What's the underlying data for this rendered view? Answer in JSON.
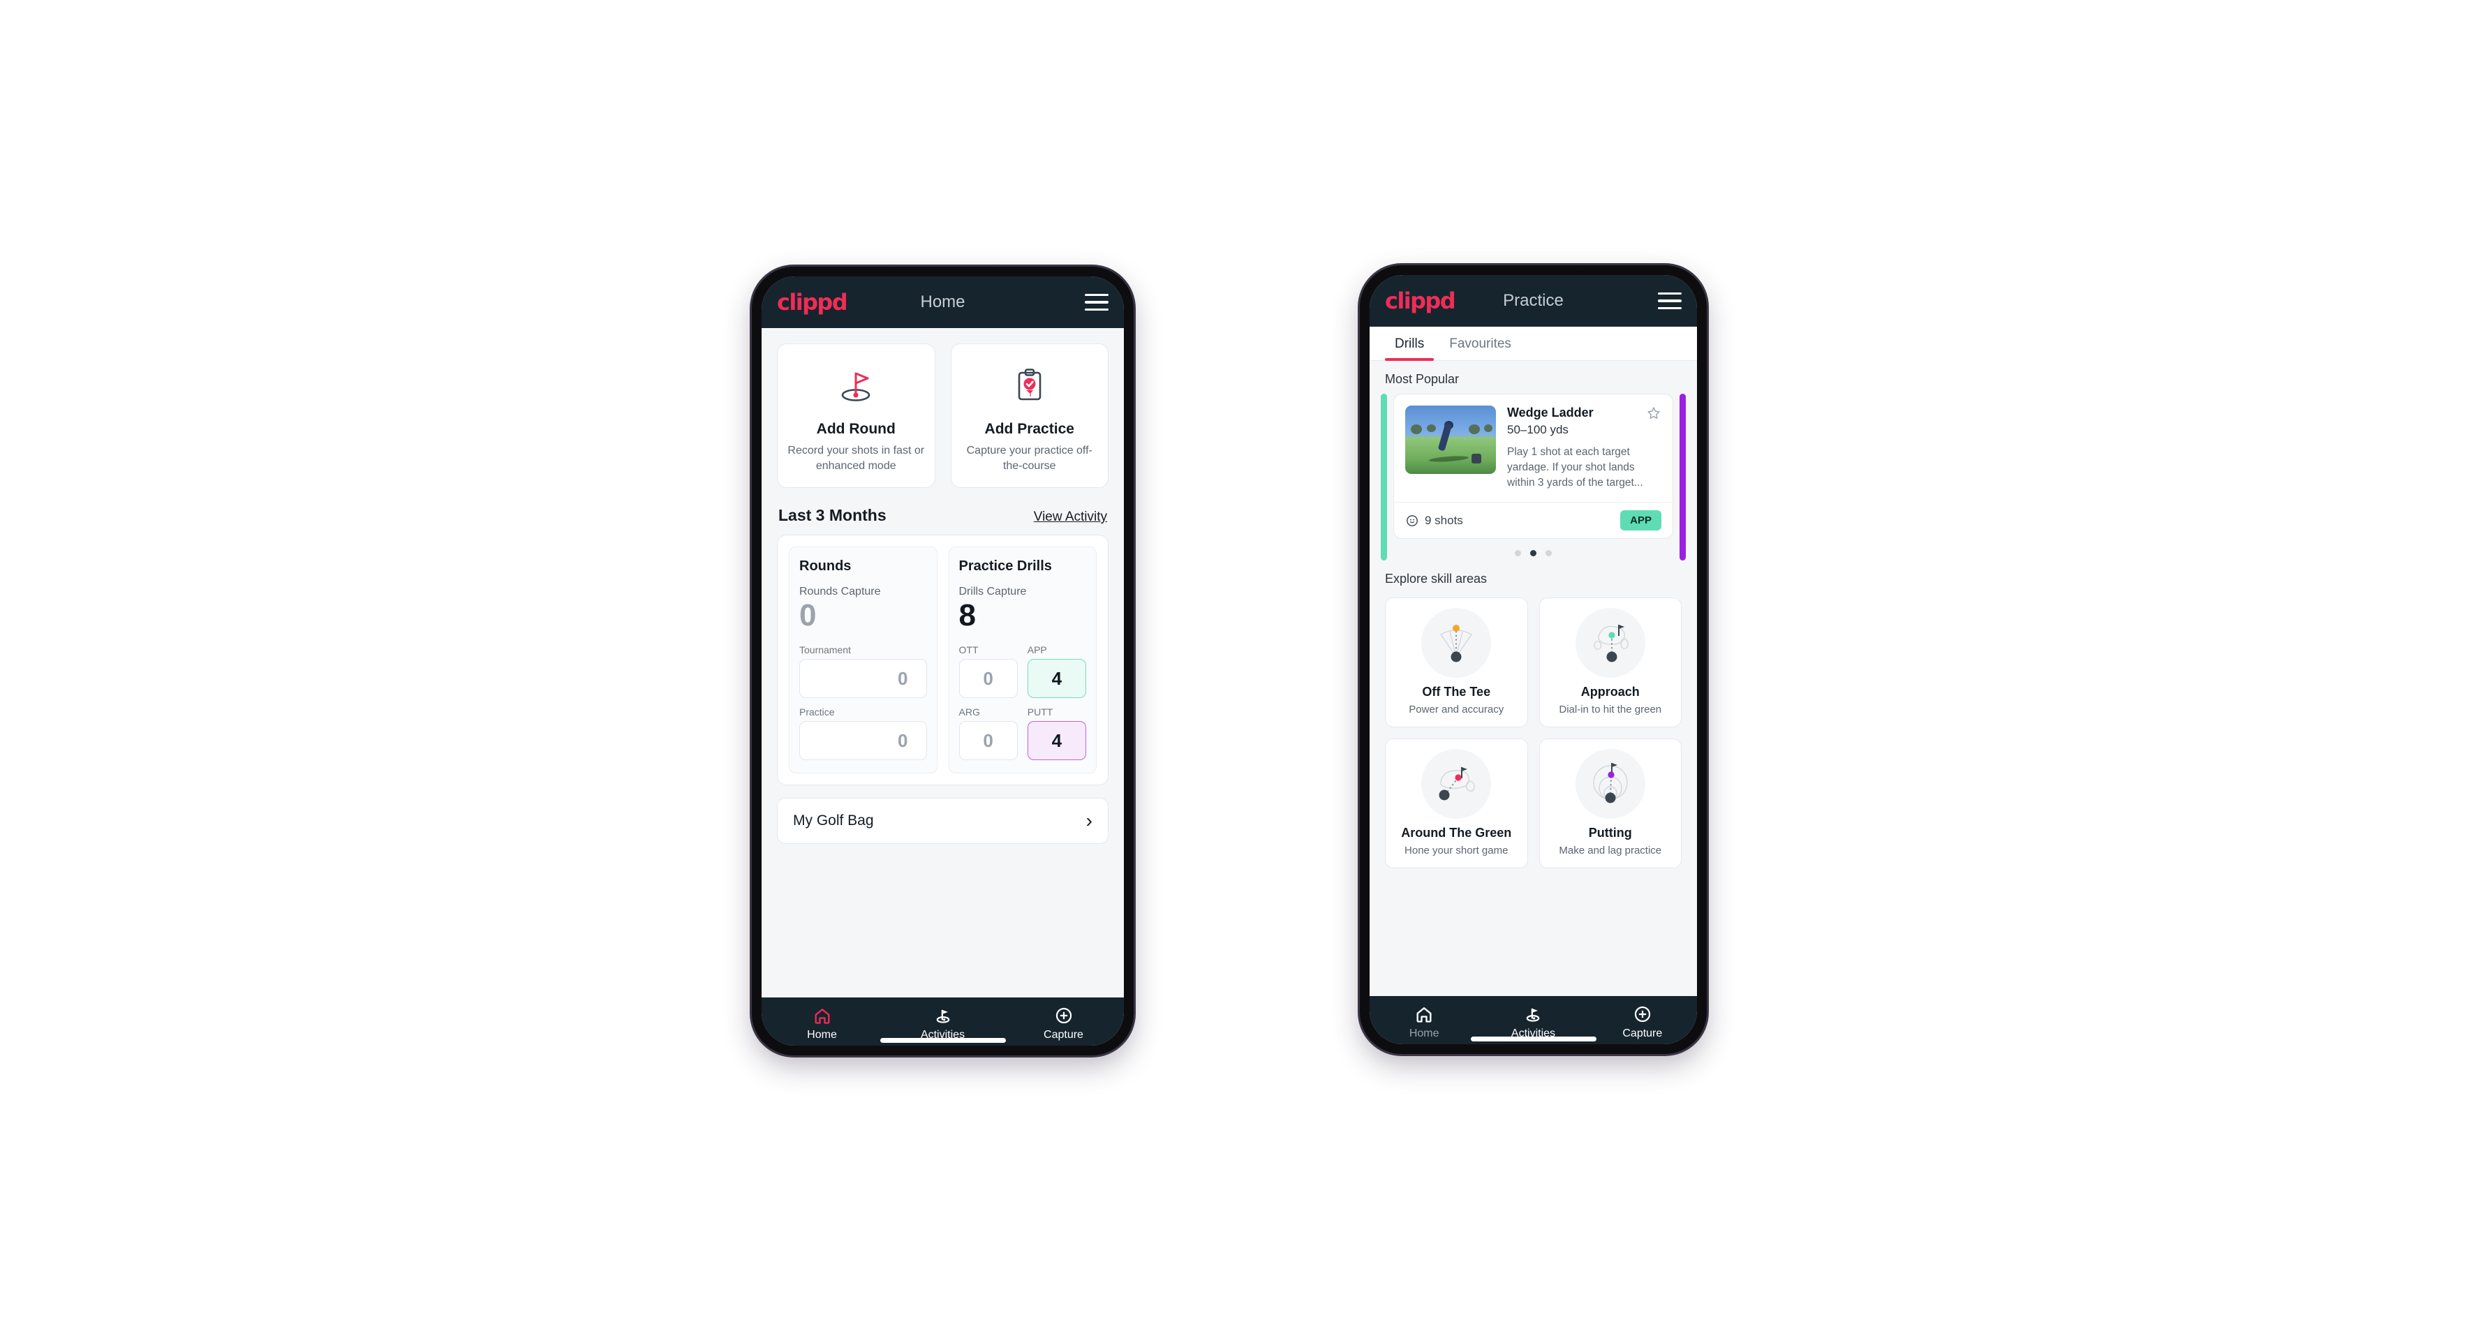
{
  "brand": {
    "logo_text": "clippd",
    "accent": "#ef2d56",
    "dark": "#16242e"
  },
  "phone_home": {
    "appbar": {
      "title": "Home",
      "menu_icon": "hamburger-icon"
    },
    "actions": [
      {
        "icon": "golf-flag-icon",
        "title": "Add Round",
        "subtitle": "Record your shots in fast or enhanced mode"
      },
      {
        "icon": "clipboard-check-icon",
        "title": "Add Practice",
        "subtitle": "Capture your practice off-the-course"
      }
    ],
    "section": {
      "title": "Last 3 Months",
      "link": "View Activity"
    },
    "stats": {
      "rounds": {
        "heading": "Rounds",
        "capture_label": "Rounds Capture",
        "capture_value": "0",
        "rows": [
          {
            "label": "Tournament",
            "value": "0"
          },
          {
            "label": "Practice",
            "value": "0"
          }
        ]
      },
      "drills": {
        "heading": "Practice Drills",
        "capture_label": "Drills Capture",
        "capture_value": "8",
        "cells": [
          {
            "label": "OTT",
            "value": "0",
            "style": "plain"
          },
          {
            "label": "APP",
            "value": "4",
            "style": "teal"
          },
          {
            "label": "ARG",
            "value": "0",
            "style": "plain"
          },
          {
            "label": "PUTT",
            "value": "4",
            "style": "violet"
          }
        ]
      }
    },
    "golf_bag": {
      "label": "My Golf Bag",
      "chevron": "chevron-right-icon"
    },
    "bottom_nav": [
      {
        "label": "Home",
        "icon": "home-icon",
        "active": true
      },
      {
        "label": "Activities",
        "icon": "golf-flag-icon",
        "active": false
      },
      {
        "label": "Capture",
        "icon": "plus-circle-icon",
        "active": false
      }
    ]
  },
  "phone_practice": {
    "appbar": {
      "title": "Practice",
      "menu_icon": "hamburger-icon"
    },
    "tabs": [
      {
        "label": "Drills",
        "active": true
      },
      {
        "label": "Favourites",
        "active": false
      }
    ],
    "most_popular_label": "Most Popular",
    "drill": {
      "title": "Wedge Ladder",
      "yardage": "50–100 yds",
      "description": "Play 1 shot at each target yardage. If your shot lands within 3 yards of the target...",
      "shots": "9 shots",
      "shots_icon": "target-icon",
      "badge": "APP",
      "badge_color": "#5fdcb4",
      "favourite_icon": "star-outline-icon",
      "edge_left_color": "#5fdcb4",
      "edge_right_color": "#9b21e0"
    },
    "carousel_dots": {
      "count": 3,
      "active_index": 1
    },
    "explore_label": "Explore skill areas",
    "skills": [
      {
        "name": "Off The Tee",
        "subtitle": "Power and accuracy",
        "icon": "tee-fan-icon",
        "dot_color": "#f4a62a"
      },
      {
        "name": "Approach",
        "subtitle": "Dial-in to hit the green",
        "icon": "green-flag-icon",
        "dot_color": "#5fdcb4"
      },
      {
        "name": "Around The Green",
        "subtitle": "Hone your short game",
        "icon": "chip-green-icon",
        "dot_color": "#ef2d56"
      },
      {
        "name": "Putting",
        "subtitle": "Make and lag practice",
        "icon": "putting-rings-icon",
        "dot_color": "#9b21e0"
      }
    ],
    "bottom_nav": [
      {
        "label": "Home",
        "icon": "home-icon",
        "active": false
      },
      {
        "label": "Activities",
        "icon": "golf-flag-icon",
        "active": true
      },
      {
        "label": "Capture",
        "icon": "plus-circle-icon",
        "active": false
      }
    ]
  }
}
